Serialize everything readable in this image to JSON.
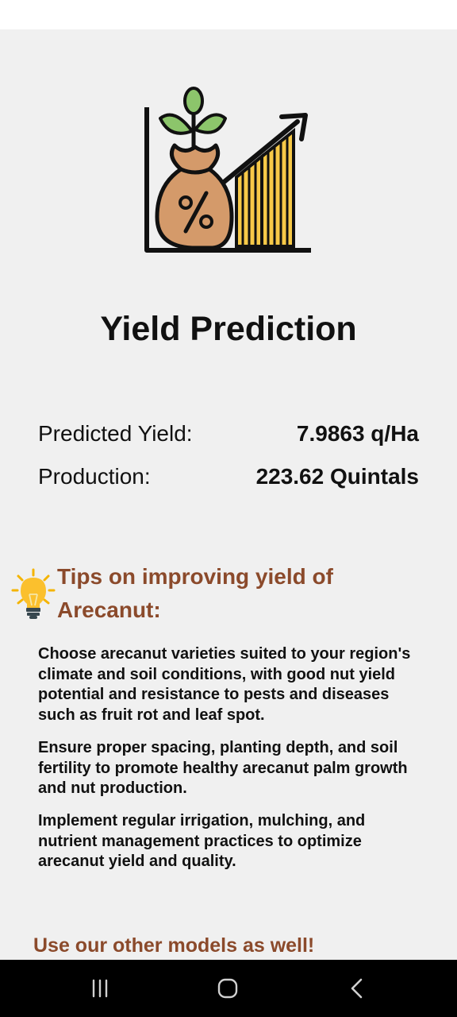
{
  "header": {
    "title": "Yield Prediction"
  },
  "hero": {
    "icon": "yield-chart-icon"
  },
  "results": {
    "predicted_yield_label": "Predicted Yield:",
    "predicted_yield_value": "7.9863 q/Ha",
    "production_label": "Production:",
    "production_value": "223.62 Quintals"
  },
  "tips": {
    "title_line1": "Tips on improving yield of",
    "title_line2": "Arecanut:",
    "icon": "lightbulb-icon",
    "items": [
      {
        "text": "Choose arecanut varieties suited to your region's climate and soil conditions, with good nut yield potential and resistance to pests and diseases such as fruit rot and leaf spot."
      },
      {
        "text": "Ensure proper spacing, planting depth, and soil fertility to promote healthy arecanut palm growth and nut production."
      },
      {
        "text": "Implement regular irrigation, mulching, and nutrient management practices to optimize arecanut yield and quality."
      }
    ]
  },
  "footer": {
    "other_models": "Use our other models as well!"
  },
  "colors": {
    "accent": "#8b4a2b",
    "background": "#f0f0f0",
    "bar_yellow": "#f7c948",
    "sack": "#d49a6a",
    "leaf": "#8cc56b"
  },
  "nav": {
    "icons": [
      "recent-apps-icon",
      "home-icon",
      "back-icon"
    ]
  }
}
